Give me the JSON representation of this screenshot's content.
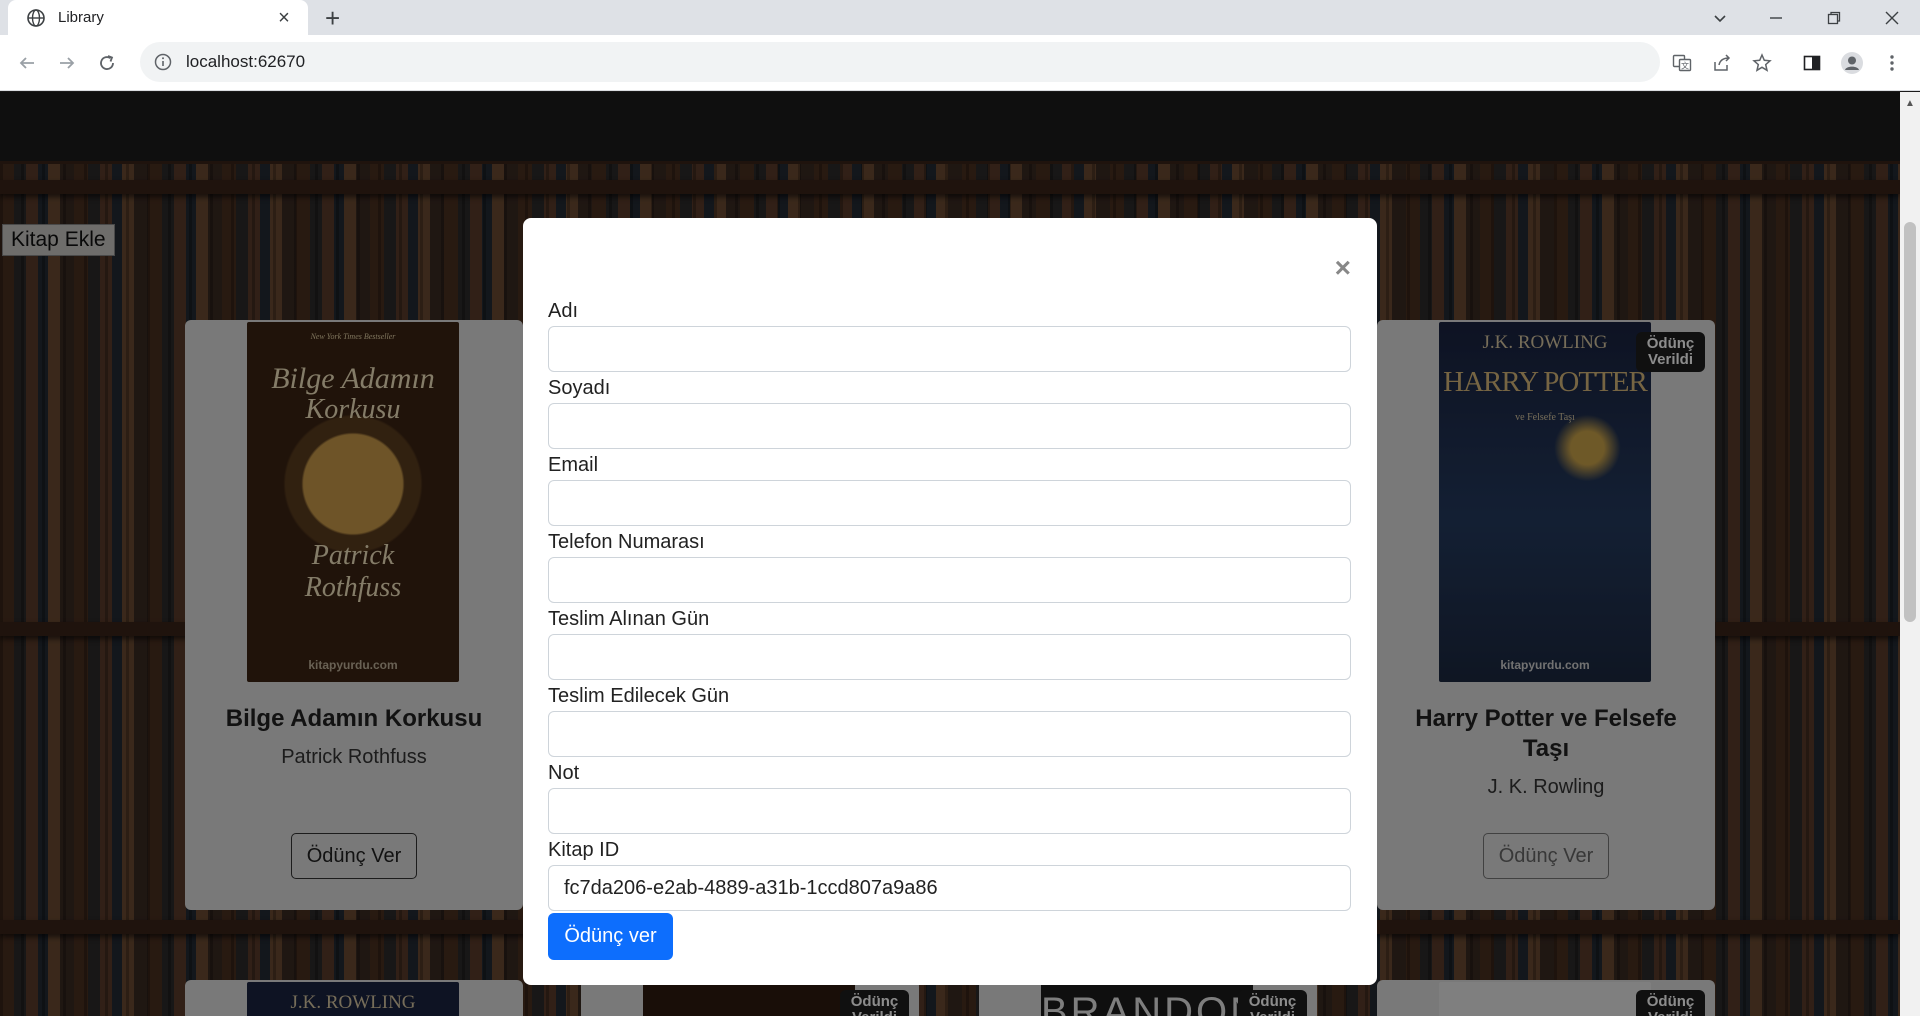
{
  "browser": {
    "tab_title": "Library",
    "url": "localhost:62670"
  },
  "page": {
    "add_book_label": "Kitap Ekle"
  },
  "cards": [
    {
      "title": "Bilge Adamın Korkusu",
      "author": "Patrick Rothfuss",
      "button": "Ödünç Ver",
      "cover": {
        "top_line": "New York Times Bestseller",
        "title_line1": "Bilge Adamın",
        "title_line2": "Korkusu",
        "author_line1": "Patrick",
        "author_line2": "Rothfuss",
        "publisher": "kitapyurdu.com"
      }
    },
    {
      "title": "Harry Potter ve Felsefe Taşı",
      "author": "J. K. Rowling",
      "button": "Ödünç Ver",
      "badge": "Ödünç Verildi",
      "cover": {
        "author": "J.K. ROWLING",
        "title": "HARRY POTTER",
        "sub": "ve Felsefe Taşı",
        "publisher": "kitapyurdu.com"
      }
    }
  ],
  "bottom_row": {
    "cover_text_1": "J.K. ROWLING",
    "cover_text_3": "BRANDON",
    "badge": "Ödünç Verildi"
  },
  "modal": {
    "fields": [
      {
        "label": "Adı",
        "value": ""
      },
      {
        "label": "Soyadı",
        "value": ""
      },
      {
        "label": "Email",
        "value": ""
      },
      {
        "label": "Telefon Numarası",
        "value": ""
      },
      {
        "label": "Teslim Alınan Gün",
        "value": ""
      },
      {
        "label": "Teslim Edilecek Gün",
        "value": ""
      },
      {
        "label": "Not",
        "value": ""
      },
      {
        "label": "Kitap ID",
        "value": "fc7da206-e2ab-4889-a31b-1ccd807a9a86"
      }
    ],
    "submit_label": "Ödünç ver",
    "close_glyph": "×"
  },
  "colors": {
    "primary": "#0d6efd",
    "badge_bg": "#1e1e1e",
    "card_bg": "#dcdcdc"
  }
}
